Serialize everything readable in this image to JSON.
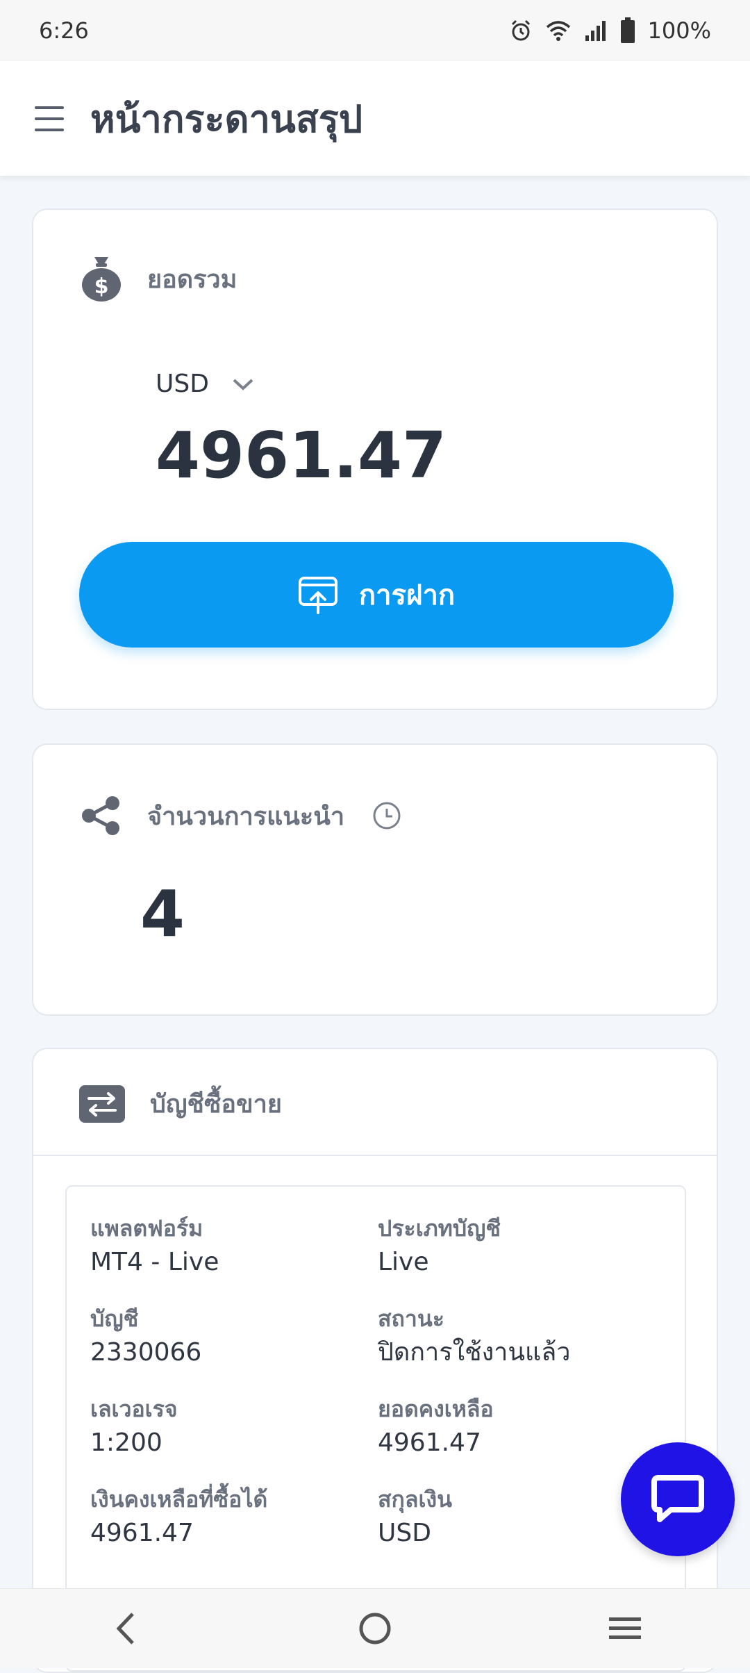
{
  "status_bar": {
    "time": "6:26",
    "battery": "100%",
    "icons": [
      "alarm-icon",
      "wifi-icon",
      "signal-icon",
      "battery-icon"
    ]
  },
  "header": {
    "title": "หน้ากระดานสรุป",
    "menu_icon": "hamburger-menu-icon"
  },
  "balance": {
    "label": "ยอดรวม",
    "currency": "USD",
    "total": "4961.47",
    "deposit_label": "การฝาก",
    "accent_color": "#0a9af2"
  },
  "referral": {
    "label": "จำนวนการแนะนำ",
    "count": "4"
  },
  "accounts": {
    "label": "บัญชีซื้อขาย",
    "fields": [
      {
        "label": "แพลตฟอร์ม",
        "value": "MT4 - Live"
      },
      {
        "label": "ประเภทบัญชี",
        "value": "Live"
      },
      {
        "label": "บัญชี",
        "value": "2330066"
      },
      {
        "label": "สถานะ",
        "value": "ปิดการใช้งานแล้ว"
      },
      {
        "label": "เลเวอเรจ",
        "value": "1:200"
      },
      {
        "label": "ยอดคงเหลือ",
        "value": "4961.47"
      },
      {
        "label": "เงินคงเหลือที่ซื้อได้",
        "value": "4961.47"
      },
      {
        "label": "สกุลเงิน",
        "value": "USD"
      }
    ]
  },
  "chat": {
    "icon": "chat-bubble-icon",
    "color": "#1f13e6"
  },
  "navbar": {
    "icons": [
      "back-icon",
      "home-icon",
      "recents-icon"
    ]
  }
}
